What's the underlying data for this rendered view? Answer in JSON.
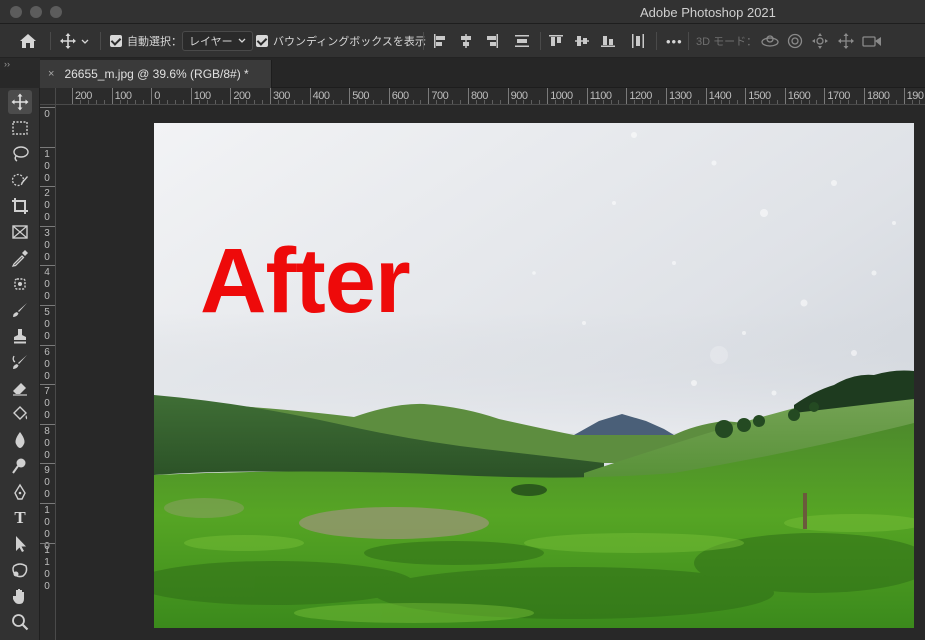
{
  "window": {
    "app_title": "Adobe Photoshop 2021"
  },
  "options_bar": {
    "auto_select_label": "自動選択：",
    "auto_select_checked": true,
    "auto_select_target": "レイヤー",
    "show_bounding_box_label": "バウンディングボックスを表示",
    "show_bounding_box_checked": true,
    "more_label": "•••",
    "three_d_mode_label": "3D モード："
  },
  "tools_collapse": "››",
  "document_tab": {
    "title": "26655_m.jpg @ 39.6% (RGB/8#) *",
    "close": "×"
  },
  "ruler": {
    "horizontal_labels": [
      "200",
      "100",
      "0",
      "100",
      "200",
      "300",
      "400",
      "500",
      "600",
      "700",
      "800",
      "900",
      "1000",
      "1100",
      "1200",
      "1300",
      "1400",
      "1500",
      "1600",
      "1700",
      "1800",
      "190"
    ],
    "vertical_labels": [
      "0",
      "100",
      "200",
      "300",
      "400",
      "500",
      "600",
      "700",
      "800",
      "900",
      "1000",
      "1100"
    ]
  },
  "tools": [
    {
      "name": "move-tool",
      "icon": "move-icon"
    },
    {
      "name": "marquee-tool",
      "icon": "rect-marquee-icon"
    },
    {
      "name": "lasso-tool",
      "icon": "lasso-icon"
    },
    {
      "name": "quick-select-tool",
      "icon": "quick-select-icon"
    },
    {
      "name": "crop-tool",
      "icon": "crop-icon"
    },
    {
      "name": "frame-tool",
      "icon": "frame-icon"
    },
    {
      "name": "eyedropper-tool",
      "icon": "eyedropper-icon"
    },
    {
      "name": "healing-tool",
      "icon": "healing-icon"
    },
    {
      "name": "brush-tool",
      "icon": "brush-icon"
    },
    {
      "name": "stamp-tool",
      "icon": "stamp-icon"
    },
    {
      "name": "history-brush-tool",
      "icon": "history-brush-icon"
    },
    {
      "name": "eraser-tool",
      "icon": "eraser-icon"
    },
    {
      "name": "paint-bucket-tool",
      "icon": "paint-bucket-icon"
    },
    {
      "name": "blur-tool",
      "icon": "blur-drop-icon"
    },
    {
      "name": "dodge-tool",
      "icon": "dodge-icon"
    },
    {
      "name": "pen-tool",
      "icon": "pen-icon"
    },
    {
      "name": "type-tool",
      "icon": "type-icon",
      "label": "T"
    },
    {
      "name": "path-select-tool",
      "icon": "arrow-icon"
    },
    {
      "name": "shape-tool",
      "icon": "shape-icon"
    },
    {
      "name": "hand-tool",
      "icon": "hand-icon"
    },
    {
      "name": "zoom-tool",
      "icon": "zoom-icon"
    }
  ],
  "canvas": {
    "overlay_text": "After",
    "overlay_color": "#ee0a0a"
  },
  "colors": {
    "panel": "#323232",
    "workspace": "#282828",
    "accent_text": "#ee0a0a"
  }
}
